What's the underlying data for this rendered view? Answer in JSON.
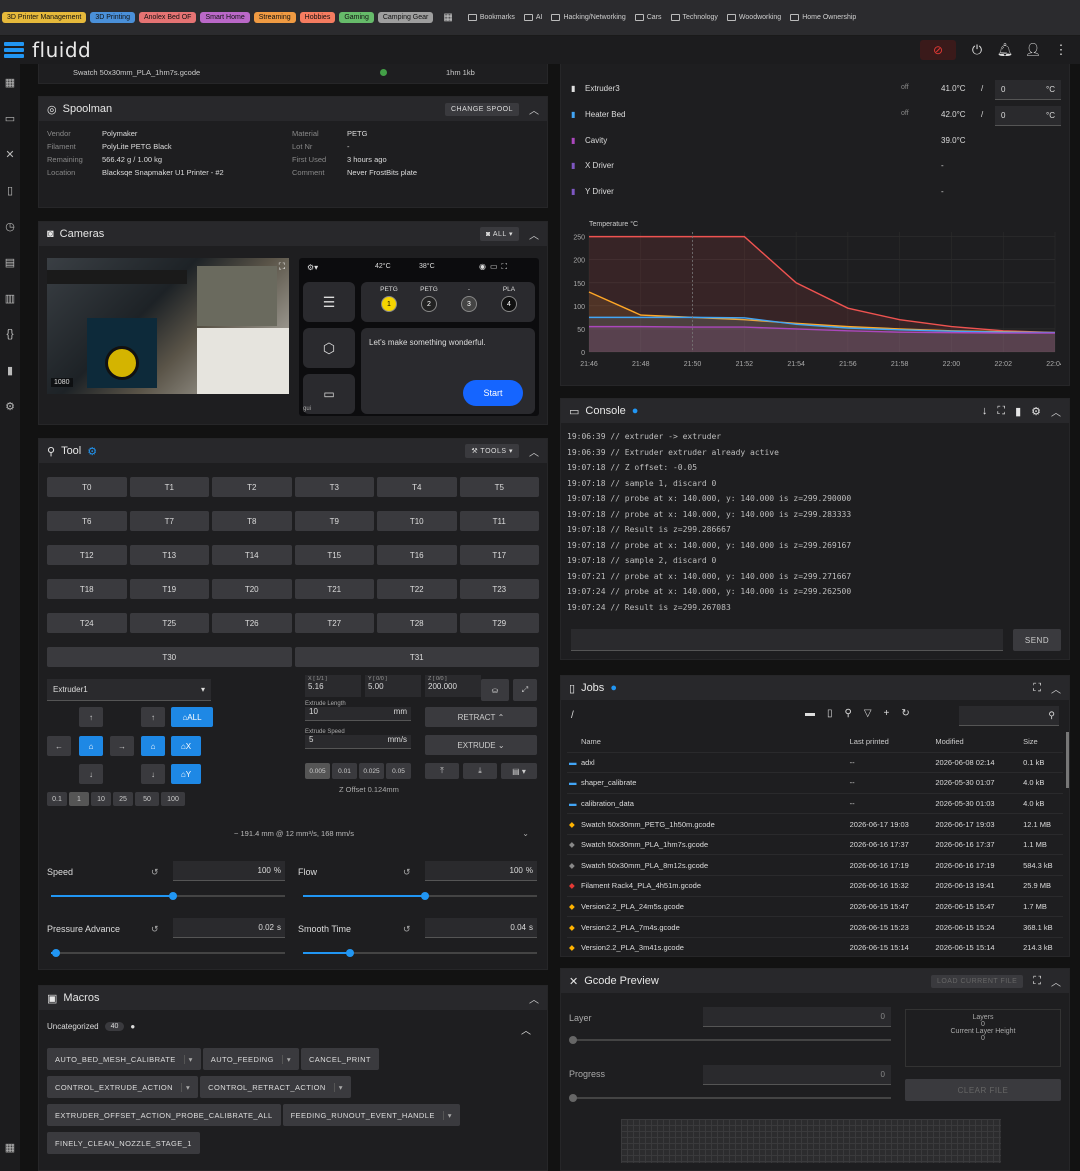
{
  "bookmarks": {
    "chips": [
      {
        "label": "3D Printer Management",
        "color": "#e6b93b"
      },
      {
        "label": "3D Printing",
        "color": "#4a90d9"
      },
      {
        "label": "Anolex Bed OF",
        "color": "#e57373"
      },
      {
        "label": "Smart Home",
        "color": "#ba68c8"
      },
      {
        "label": "Streaming",
        "color": "#ef9a42"
      },
      {
        "label": "Hobbies",
        "color": "#f57c60"
      },
      {
        "label": "Gaming",
        "color": "#66bb6a"
      },
      {
        "label": "Camping Gear",
        "color": "#9e9e9e"
      }
    ],
    "folders": [
      "Bookmarks",
      "AI",
      "Hacking/Networking",
      "Cars",
      "Technology",
      "Woodworking",
      "Home Ownership"
    ]
  },
  "app": {
    "title": "fluidd"
  },
  "file_strip": {
    "name": "Swatch 50x30mm_PLA_1hm7s.gcode",
    "size": "1hm 1kb"
  },
  "spoolman": {
    "title": "Spoolman",
    "change_label": "CHANGE SPOOL",
    "fields": [
      {
        "k": "Vendor",
        "v": "Polymaker",
        "k2": "Material",
        "v2": "PETG"
      },
      {
        "k": "Filament",
        "v": "PolyLite PETG Black",
        "k2": "Lot Nr",
        "v2": "-"
      },
      {
        "k": "Remaining",
        "v": "566.42 g / 1.00 kg",
        "k2": "First Used",
        "v2": "3 hours ago"
      },
      {
        "k": "Location",
        "v": "Blacksqe Snapmaker U1 Printer - #2",
        "k2": "Comment",
        "v2": "Never FrostBits plate"
      }
    ]
  },
  "cameras": {
    "title": "Cameras",
    "all_label": "ALL",
    "cam_time": "1080",
    "screen": {
      "temp1": "42°C",
      "temp2": "38°C",
      "slots": [
        {
          "mat": "PETG",
          "n": "1",
          "color": "#f5d400"
        },
        {
          "mat": "PETG",
          "n": "2",
          "color": "#222"
        },
        {
          "mat": "-",
          "n": "3",
          "color": "#444"
        },
        {
          "mat": "PLA",
          "n": "4",
          "color": "#111"
        }
      ],
      "message": "Let's make something wonderful.",
      "start": "Start",
      "footer": "gui"
    }
  },
  "tool": {
    "title": "Tool",
    "tools_label": "TOOLS",
    "rows": [
      [
        "T0",
        "T1",
        "T2",
        "T3",
        "T4",
        "T5"
      ],
      [
        "T6",
        "T7",
        "T8",
        "T9",
        "T10",
        "T11"
      ],
      [
        "T12",
        "T13",
        "T14",
        "T15",
        "T16",
        "T17"
      ],
      [
        "T18",
        "T19",
        "T20",
        "T21",
        "T22",
        "T23"
      ],
      [
        "T24",
        "T25",
        "T26",
        "T27",
        "T28",
        "T29"
      ],
      [
        "T30",
        "T31"
      ]
    ],
    "extruder_select": "Extruder1",
    "home_all": "ALL",
    "home_x": "X",
    "home_y": "Y",
    "steps": [
      "0.1",
      "1",
      "10",
      "25",
      "50",
      "100"
    ],
    "pos": [
      {
        "label": "X [ 1/1 ]",
        "value": "5.16"
      },
      {
        "label": "Y [ 0/0 ]",
        "value": "5.00"
      },
      {
        "label": "Z [ 0/0 ]",
        "value": "200.000"
      }
    ],
    "extrude_length_label": "Extrude Length",
    "extrude_length": "10",
    "extrude_length_unit": "mm",
    "extrude_speed_label": "Extrude Speed",
    "extrude_speed": "5",
    "extrude_speed_unit": "mm/s",
    "retract": "RETRACT",
    "extrude": "EXTRUDE",
    "zsteps": [
      "0.005",
      "0.01",
      "0.025",
      "0.05"
    ],
    "z_offset": "Z Offset 0.124mm",
    "rate_text": "~ 191.4 mm @ 12 mm³/s, 168 mm/s",
    "speed_label": "Speed",
    "speed": "100",
    "speed_unit": "%",
    "flow_label": "Flow",
    "flow": "100",
    "flow_unit": "%",
    "pa_label": "Pressure Advance",
    "pa": "0.02",
    "pa_unit": "s",
    "st_label": "Smooth Time",
    "st": "0.04",
    "st_unit": "s",
    "speed_frac": 0.52,
    "flow_frac": 0.52,
    "pa_frac": 0.02,
    "st_frac": 0.2
  },
  "macros": {
    "title": "Macros",
    "group": "Uncategorized",
    "count": "40",
    "items": [
      {
        "label": "AUTO_BED_MESH_CALIBRATE",
        "dd": true
      },
      {
        "label": "AUTO_FEEDING",
        "dd": true
      },
      {
        "label": "CANCEL_PRINT",
        "dd": false
      },
      {
        "label": "CONTROL_EXTRUDE_ACTION",
        "dd": true
      },
      {
        "label": "CONTROL_RETRACT_ACTION",
        "dd": true
      },
      {
        "label": "EXTRUDER_OFFSET_ACTION_PROBE_CALIBRATE_ALL",
        "dd": false
      },
      {
        "label": "FEEDING_RUNOUT_EVENT_HANDLE",
        "dd": true
      },
      {
        "label": "FINELY_CLEAN_NOZZLE_STAGE_1",
        "dd": false
      }
    ]
  },
  "thermals": {
    "rows": [
      {
        "name": "Extruder3",
        "color": "#e0e0e0",
        "power": "off",
        "actual": "41.0°C",
        "target": "0",
        "unit": "°C"
      },
      {
        "name": "Heater Bed",
        "color": "#42a5f5",
        "power": "off",
        "actual": "42.0°C",
        "target": "0",
        "unit": "°C"
      },
      {
        "name": "Cavity",
        "color": "#ab47bc",
        "power": "",
        "actual": "39.0°C",
        "target": "",
        "unit": ""
      },
      {
        "name": "X Driver",
        "color": "#7e57c2",
        "power": "",
        "actual": "-",
        "target": "",
        "unit": ""
      },
      {
        "name": "Y Driver",
        "color": "#7e57c2",
        "power": "",
        "actual": "-",
        "target": "",
        "unit": ""
      }
    ]
  },
  "chart_data": {
    "type": "line",
    "ylabel": "Temperature °C",
    "ylim": [
      0,
      260
    ],
    "yticks": [
      0,
      50,
      100,
      150,
      200,
      250
    ],
    "x": [
      "21:46",
      "21:48",
      "21:50",
      "21:52",
      "21:54",
      "21:56",
      "21:58",
      "22:00",
      "22:02",
      "22:04"
    ],
    "grid": true,
    "series": [
      {
        "color": "#ef5350",
        "values": [
          250,
          250,
          250,
          250,
          150,
          95,
          70,
          55,
          46,
          42
        ]
      },
      {
        "color": "#ffa726",
        "values": [
          130,
          80,
          75,
          70,
          62,
          55,
          50,
          46,
          44,
          42
        ]
      },
      {
        "color": "#42a5f5",
        "values": [
          75,
          75,
          75,
          74,
          60,
          52,
          48,
          45,
          43,
          42
        ]
      },
      {
        "color": "#ab47bc",
        "values": [
          55,
          55,
          54,
          54,
          50,
          46,
          43,
          42,
          41,
          41
        ]
      }
    ]
  },
  "console": {
    "title": "Console",
    "lines": [
      "19:06:39  // extruder  -> extruder",
      "19:06:39  // Extruder extruder already active",
      "19:07:18  // Z offset: -0.05",
      "19:07:18  // sample 1, discard 0",
      "19:07:18  // probe at x: 140.000, y: 140.000 is z=299.290000",
      "19:07:18  // probe at x: 140.000, y: 140.000 is z=299.283333",
      "19:07:18  // Result is z=299.286667",
      "19:07:18  // probe at x: 140.000, y: 140.000 is z=299.269167",
      "19:07:18  // sample 2, discard 0",
      "19:07:21  // probe at x: 140.000, y: 140.000 is z=299.271667",
      "19:07:24  // probe at x: 140.000, y: 140.000 is z=299.262500",
      "19:07:24  // Result is z=299.267083"
    ],
    "send": "SEND"
  },
  "jobs": {
    "title": "Jobs",
    "path": "/",
    "headers": [
      "Name",
      "Last printed",
      "Modified",
      "Size"
    ],
    "rows": [
      {
        "name": "adxl",
        "last": "--",
        "mod": "2026-06-08 02:14",
        "size": "0.1 kB",
        "icon": "folder",
        "color": "#42a5f5"
      },
      {
        "name": "shaper_calibrate",
        "last": "--",
        "mod": "2026-05-30 01:07",
        "size": "4.0 kB",
        "icon": "folder",
        "color": "#42a5f5"
      },
      {
        "name": "calibration_data",
        "last": "--",
        "mod": "2026-05-30 01:03",
        "size": "4.0 kB",
        "icon": "folder",
        "color": "#42a5f5"
      },
      {
        "name": "Swatch 50x30mm_PETG_1h50m.gcode",
        "last": "2026-06-17 19:03",
        "mod": "2026-06-17 19:03",
        "size": "12.1 MB",
        "icon": "file",
        "color": "#ffb300"
      },
      {
        "name": "Swatch 50x30mm_PLA_1hm7s.gcode",
        "last": "2026-06-16 17:37",
        "mod": "2026-06-16 17:37",
        "size": "1.1 MB",
        "icon": "file",
        "color": "#888"
      },
      {
        "name": "Swatch 50x30mm_PLA_8m12s.gcode",
        "last": "2026-06-16 17:19",
        "mod": "2026-06-16 17:19",
        "size": "584.3 kB",
        "icon": "file",
        "color": "#888"
      },
      {
        "name": "Filament Rack4_PLA_4h51m.gcode",
        "last": "2026-06-16 15:32",
        "mod": "2026-06-13 19:41",
        "size": "25.9 MB",
        "icon": "file",
        "color": "#e53935"
      },
      {
        "name": "Version2.2_PLA_24m5s.gcode",
        "last": "2026-06-15 15:47",
        "mod": "2026-06-15 15:47",
        "size": "1.7 MB",
        "icon": "file",
        "color": "#ffb300"
      },
      {
        "name": "Version2.2_PLA_7m4s.gcode",
        "last": "2026-06-15 15:23",
        "mod": "2026-06-15 15:24",
        "size": "368.1 kB",
        "icon": "file",
        "color": "#ffb300"
      },
      {
        "name": "Version2.2_PLA_3m41s.gcode",
        "last": "2026-06-15 15:14",
        "mod": "2026-06-15 15:14",
        "size": "214.3 kB",
        "icon": "file",
        "color": "#ffb300"
      }
    ]
  },
  "gcode": {
    "title": "Gcode Preview",
    "load_label": "LOAD CURRENT FILE",
    "layer_label": "Layer",
    "layer_val": "0",
    "progress_label": "Progress",
    "progress_val": "0",
    "layers_label": "Layers",
    "layers_val": "0",
    "layer_height_label": "Current Layer Height",
    "layer_height_val": "0",
    "clear_label": "CLEAR FILE"
  }
}
